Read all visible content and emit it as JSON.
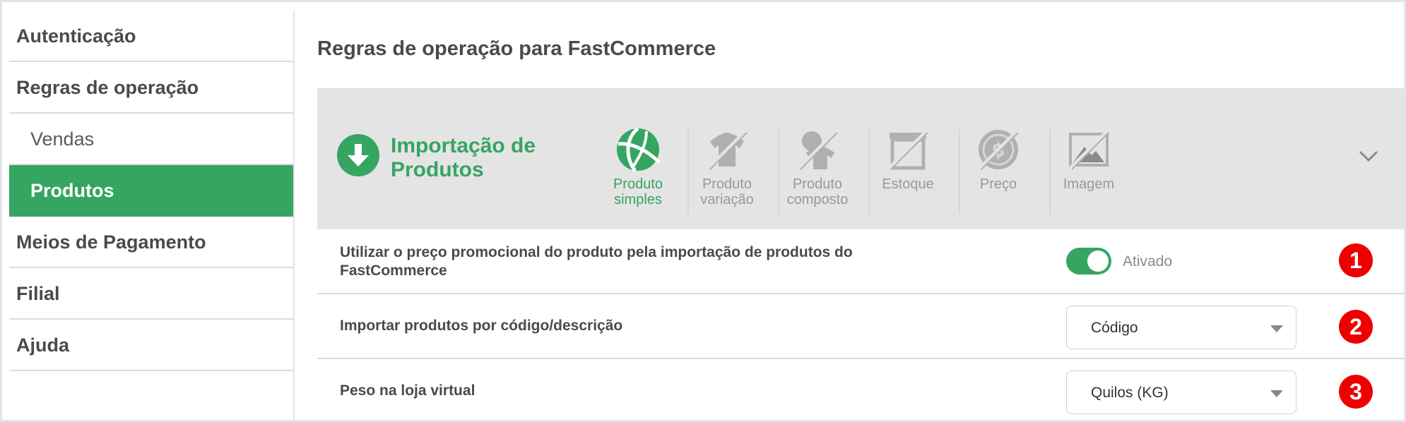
{
  "sidebar": {
    "items": [
      {
        "label": "Autenticação"
      },
      {
        "label": "Regras de operação"
      },
      {
        "label": "Vendas"
      },
      {
        "label": "Produtos"
      },
      {
        "label": "Meios de Pagamento"
      },
      {
        "label": "Filial"
      },
      {
        "label": "Ajuda"
      }
    ]
  },
  "main": {
    "title": "Regras de operação para FastCommerce",
    "panel": {
      "title_line1": "Importação de",
      "title_line2": "Produtos",
      "tabs": [
        {
          "line1": "Produto",
          "line2": "simples",
          "icon": "beach-ball-icon",
          "active": true
        },
        {
          "line1": "Produto",
          "line2": "variação",
          "icon": "shirt-icon",
          "active": false
        },
        {
          "line1": "Produto",
          "line2": "composto",
          "icon": "composite-product-icon",
          "active": false
        },
        {
          "line1": "Estoque",
          "line2": "",
          "icon": "stock-icon",
          "active": false
        },
        {
          "line1": "Preço",
          "line2": "",
          "icon": "price-icon",
          "active": false
        },
        {
          "line1": "Imagem",
          "line2": "",
          "icon": "image-icon",
          "active": false
        }
      ]
    },
    "settings": [
      {
        "label_line1": "Utilizar o preço promocional do produto pela importação de produtos do",
        "label_line2": "FastCommerce",
        "control": "toggle",
        "toggle_text": "Ativado",
        "badge": "1"
      },
      {
        "label_line1": "Importar produtos por código/descrição",
        "control": "select",
        "value": "Código",
        "badge": "2"
      },
      {
        "label_line1": "Peso na loja virtual",
        "control": "select",
        "value": "Quilos (KG)",
        "badge": "3"
      }
    ]
  },
  "colors": {
    "accent": "#36a562",
    "badge": "#ee0000",
    "panel_bg": "#e4e4e4",
    "disabled_icon": "#b0b0b0"
  }
}
